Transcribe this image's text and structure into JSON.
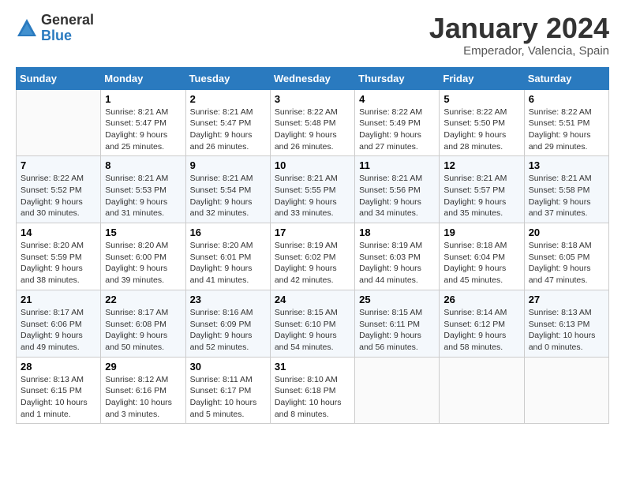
{
  "header": {
    "logo_general": "General",
    "logo_blue": "Blue",
    "month_title": "January 2024",
    "subtitle": "Emperador, Valencia, Spain"
  },
  "weekdays": [
    "Sunday",
    "Monday",
    "Tuesday",
    "Wednesday",
    "Thursday",
    "Friday",
    "Saturday"
  ],
  "weeks": [
    [
      {
        "date": "",
        "sunrise": "",
        "sunset": "",
        "daylight": ""
      },
      {
        "date": "1",
        "sunrise": "Sunrise: 8:21 AM",
        "sunset": "Sunset: 5:47 PM",
        "daylight": "Daylight: 9 hours and 25 minutes."
      },
      {
        "date": "2",
        "sunrise": "Sunrise: 8:21 AM",
        "sunset": "Sunset: 5:47 PM",
        "daylight": "Daylight: 9 hours and 26 minutes."
      },
      {
        "date": "3",
        "sunrise": "Sunrise: 8:22 AM",
        "sunset": "Sunset: 5:48 PM",
        "daylight": "Daylight: 9 hours and 26 minutes."
      },
      {
        "date": "4",
        "sunrise": "Sunrise: 8:22 AM",
        "sunset": "Sunset: 5:49 PM",
        "daylight": "Daylight: 9 hours and 27 minutes."
      },
      {
        "date": "5",
        "sunrise": "Sunrise: 8:22 AM",
        "sunset": "Sunset: 5:50 PM",
        "daylight": "Daylight: 9 hours and 28 minutes."
      },
      {
        "date": "6",
        "sunrise": "Sunrise: 8:22 AM",
        "sunset": "Sunset: 5:51 PM",
        "daylight": "Daylight: 9 hours and 29 minutes."
      }
    ],
    [
      {
        "date": "7",
        "sunrise": "Sunrise: 8:22 AM",
        "sunset": "Sunset: 5:52 PM",
        "daylight": "Daylight: 9 hours and 30 minutes."
      },
      {
        "date": "8",
        "sunrise": "Sunrise: 8:21 AM",
        "sunset": "Sunset: 5:53 PM",
        "daylight": "Daylight: 9 hours and 31 minutes."
      },
      {
        "date": "9",
        "sunrise": "Sunrise: 8:21 AM",
        "sunset": "Sunset: 5:54 PM",
        "daylight": "Daylight: 9 hours and 32 minutes."
      },
      {
        "date": "10",
        "sunrise": "Sunrise: 8:21 AM",
        "sunset": "Sunset: 5:55 PM",
        "daylight": "Daylight: 9 hours and 33 minutes."
      },
      {
        "date": "11",
        "sunrise": "Sunrise: 8:21 AM",
        "sunset": "Sunset: 5:56 PM",
        "daylight": "Daylight: 9 hours and 34 minutes."
      },
      {
        "date": "12",
        "sunrise": "Sunrise: 8:21 AM",
        "sunset": "Sunset: 5:57 PM",
        "daylight": "Daylight: 9 hours and 35 minutes."
      },
      {
        "date": "13",
        "sunrise": "Sunrise: 8:21 AM",
        "sunset": "Sunset: 5:58 PM",
        "daylight": "Daylight: 9 hours and 37 minutes."
      }
    ],
    [
      {
        "date": "14",
        "sunrise": "Sunrise: 8:20 AM",
        "sunset": "Sunset: 5:59 PM",
        "daylight": "Daylight: 9 hours and 38 minutes."
      },
      {
        "date": "15",
        "sunrise": "Sunrise: 8:20 AM",
        "sunset": "Sunset: 6:00 PM",
        "daylight": "Daylight: 9 hours and 39 minutes."
      },
      {
        "date": "16",
        "sunrise": "Sunrise: 8:20 AM",
        "sunset": "Sunset: 6:01 PM",
        "daylight": "Daylight: 9 hours and 41 minutes."
      },
      {
        "date": "17",
        "sunrise": "Sunrise: 8:19 AM",
        "sunset": "Sunset: 6:02 PM",
        "daylight": "Daylight: 9 hours and 42 minutes."
      },
      {
        "date": "18",
        "sunrise": "Sunrise: 8:19 AM",
        "sunset": "Sunset: 6:03 PM",
        "daylight": "Daylight: 9 hours and 44 minutes."
      },
      {
        "date": "19",
        "sunrise": "Sunrise: 8:18 AM",
        "sunset": "Sunset: 6:04 PM",
        "daylight": "Daylight: 9 hours and 45 minutes."
      },
      {
        "date": "20",
        "sunrise": "Sunrise: 8:18 AM",
        "sunset": "Sunset: 6:05 PM",
        "daylight": "Daylight: 9 hours and 47 minutes."
      }
    ],
    [
      {
        "date": "21",
        "sunrise": "Sunrise: 8:17 AM",
        "sunset": "Sunset: 6:06 PM",
        "daylight": "Daylight: 9 hours and 49 minutes."
      },
      {
        "date": "22",
        "sunrise": "Sunrise: 8:17 AM",
        "sunset": "Sunset: 6:08 PM",
        "daylight": "Daylight: 9 hours and 50 minutes."
      },
      {
        "date": "23",
        "sunrise": "Sunrise: 8:16 AM",
        "sunset": "Sunset: 6:09 PM",
        "daylight": "Daylight: 9 hours and 52 minutes."
      },
      {
        "date": "24",
        "sunrise": "Sunrise: 8:15 AM",
        "sunset": "Sunset: 6:10 PM",
        "daylight": "Daylight: 9 hours and 54 minutes."
      },
      {
        "date": "25",
        "sunrise": "Sunrise: 8:15 AM",
        "sunset": "Sunset: 6:11 PM",
        "daylight": "Daylight: 9 hours and 56 minutes."
      },
      {
        "date": "26",
        "sunrise": "Sunrise: 8:14 AM",
        "sunset": "Sunset: 6:12 PM",
        "daylight": "Daylight: 9 hours and 58 minutes."
      },
      {
        "date": "27",
        "sunrise": "Sunrise: 8:13 AM",
        "sunset": "Sunset: 6:13 PM",
        "daylight": "Daylight: 10 hours and 0 minutes."
      }
    ],
    [
      {
        "date": "28",
        "sunrise": "Sunrise: 8:13 AM",
        "sunset": "Sunset: 6:15 PM",
        "daylight": "Daylight: 10 hours and 1 minute."
      },
      {
        "date": "29",
        "sunrise": "Sunrise: 8:12 AM",
        "sunset": "Sunset: 6:16 PM",
        "daylight": "Daylight: 10 hours and 3 minutes."
      },
      {
        "date": "30",
        "sunrise": "Sunrise: 8:11 AM",
        "sunset": "Sunset: 6:17 PM",
        "daylight": "Daylight: 10 hours and 5 minutes."
      },
      {
        "date": "31",
        "sunrise": "Sunrise: 8:10 AM",
        "sunset": "Sunset: 6:18 PM",
        "daylight": "Daylight: 10 hours and 8 minutes."
      },
      {
        "date": "",
        "sunrise": "",
        "sunset": "",
        "daylight": ""
      },
      {
        "date": "",
        "sunrise": "",
        "sunset": "",
        "daylight": ""
      },
      {
        "date": "",
        "sunrise": "",
        "sunset": "",
        "daylight": ""
      }
    ]
  ]
}
